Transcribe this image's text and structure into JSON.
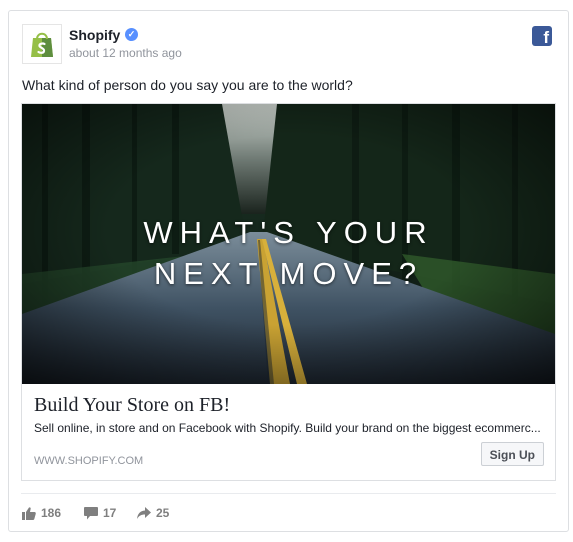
{
  "post": {
    "page_name": "Shopify",
    "verified": true,
    "timestamp": "about 12 months ago",
    "text": "What kind of person do you say you are to the world?"
  },
  "hero": {
    "line1": "WHAT'S YOUR",
    "line2": "NEXT MOVE?"
  },
  "link": {
    "title": "Build Your Store on FB!",
    "description": "Sell online, in store and on Facebook with Shopify. Build your brand on the biggest ecommerc...",
    "domain": "WWW.SHOPIFY.COM",
    "cta_label": "Sign Up"
  },
  "stats": {
    "likes": "186",
    "comments": "17",
    "shares": "25"
  },
  "icons": {
    "brand": "shopify-bag-icon",
    "verified": "verified-badge-icon",
    "platform": "facebook-icon",
    "like": "thumbs-up-icon",
    "comment": "comment-icon",
    "share": "share-arrow-icon"
  },
  "colors": {
    "facebook_blue": "#3b5998",
    "shopify_green": "#95bf47",
    "verified_blue": "#5890ff",
    "muted_text": "#90949c"
  }
}
